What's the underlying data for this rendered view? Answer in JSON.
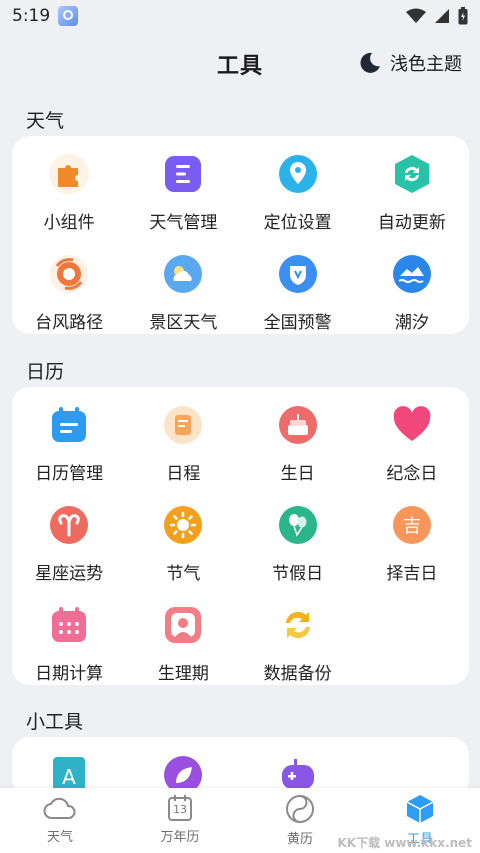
{
  "status": {
    "time": "5:19"
  },
  "header": {
    "title": "工具",
    "theme_toggle": "浅色主题"
  },
  "sections": {
    "weather": {
      "title": "天气",
      "items": [
        {
          "label": "小组件",
          "icon": "puzzle-icon",
          "color": "#f08a2b"
        },
        {
          "label": "天气管理",
          "icon": "list-icon",
          "color": "#7a5cf0"
        },
        {
          "label": "定位设置",
          "icon": "location-icon",
          "color": "#2ab3e8"
        },
        {
          "label": "自动更新",
          "icon": "refresh-icon",
          "color": "#27c2a8"
        },
        {
          "label": "台风路径",
          "icon": "typhoon-icon",
          "color": "#f0773a"
        },
        {
          "label": "景区天气",
          "icon": "scenic-weather-icon",
          "color": "#5aa9f0"
        },
        {
          "label": "全国预警",
          "icon": "warning-icon",
          "color": "#3a8ff0"
        },
        {
          "label": "潮汐",
          "icon": "tide-icon",
          "color": "#2a87e8"
        }
      ]
    },
    "calendar": {
      "title": "日历",
      "items": [
        {
          "label": "日历管理",
          "icon": "calendar-manage-icon",
          "color": "#2d9cf0"
        },
        {
          "label": "日程",
          "icon": "schedule-icon",
          "color": "#f6a65a"
        },
        {
          "label": "生日",
          "icon": "cake-icon",
          "color": "#ee6b6b"
        },
        {
          "label": "纪念日",
          "icon": "heart-icon",
          "color": "#f2477a"
        },
        {
          "label": "星座运势",
          "icon": "aries-icon",
          "color": "#ef6b5f"
        },
        {
          "label": "节气",
          "icon": "sun-icon",
          "color": "#f4a01f"
        },
        {
          "label": "节假日",
          "icon": "balloon-icon",
          "color": "#2bb58a"
        },
        {
          "label": "择吉日",
          "icon": "lucky-day-icon",
          "color": "#f6965a"
        },
        {
          "label": "日期计算",
          "icon": "date-calc-icon",
          "color": "#f26d96"
        },
        {
          "label": "生理期",
          "icon": "period-icon",
          "color": "#f27d84"
        },
        {
          "label": "数据备份",
          "icon": "backup-icon",
          "color": "#f2b21e"
        }
      ]
    },
    "small_tools": {
      "title": "小工具",
      "items": [
        {
          "label": "",
          "icon": "text-recognize-icon",
          "color": "#2fb2c8"
        },
        {
          "label": "",
          "icon": "leaf-icon",
          "color": "#9a4fe0"
        },
        {
          "label": "",
          "icon": "game-icon",
          "color": "#8a56e6"
        }
      ]
    }
  },
  "tabbar": [
    {
      "label": "天气",
      "icon": "cloud-icon",
      "active": false
    },
    {
      "label": "万年历",
      "icon": "calendar-13-icon",
      "active": false,
      "calendar_day": "13"
    },
    {
      "label": "黄历",
      "icon": "yinyang-icon",
      "active": false
    },
    {
      "label": "工具",
      "icon": "tools-box-icon",
      "active": true
    }
  ],
  "watermark": "KK下载 www.kkx.net"
}
